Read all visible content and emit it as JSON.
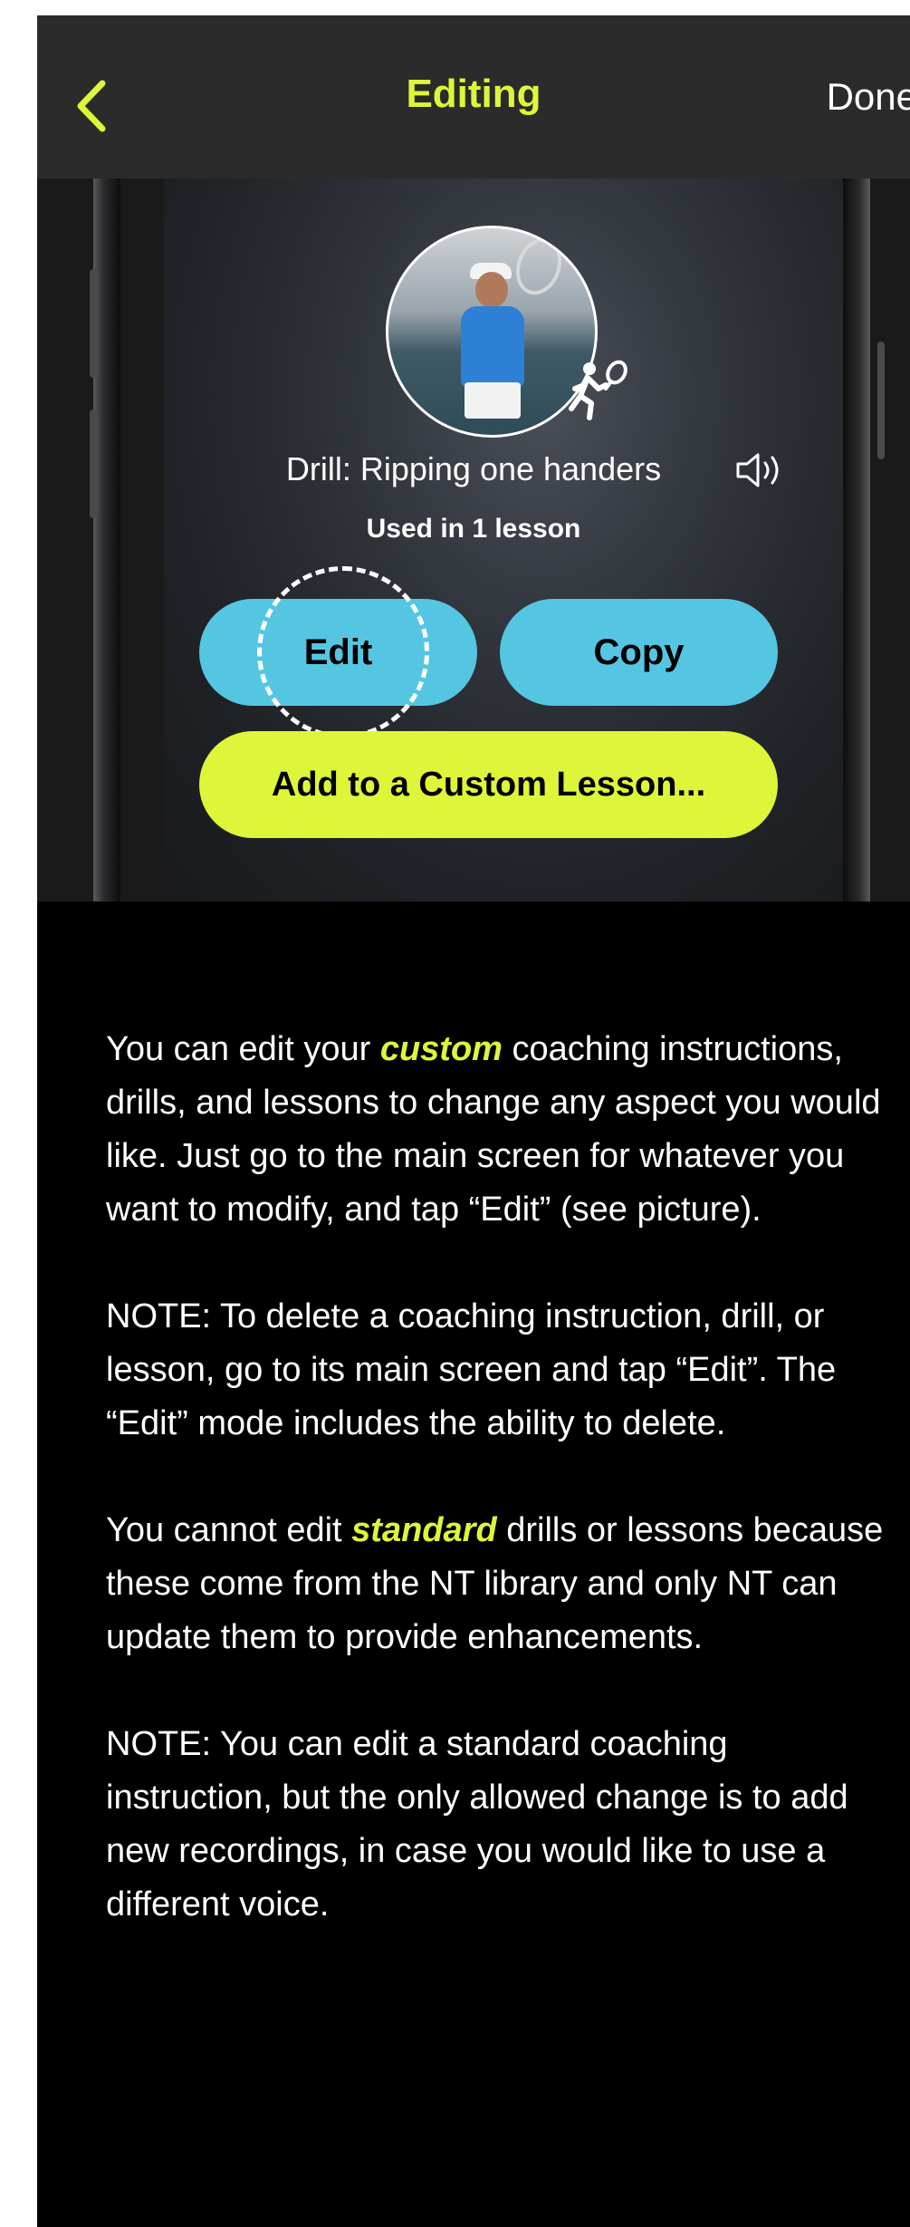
{
  "header": {
    "title": "Editing",
    "done_label": "Done",
    "back_icon": "chevron-left-icon",
    "accent_color": "#dff53a"
  },
  "picture": {
    "drill_title": "Drill: Ripping one handers",
    "used_in": "Used in 1 lesson",
    "edit_label": "Edit",
    "copy_label": "Copy",
    "add_label": "Add to a Custom Lesson...",
    "button_color": "#55c6e2"
  },
  "body": {
    "p1_pre": "You can edit your ",
    "p1_em": "custom",
    "p1_post": " coaching instructions, drills, and lessons to change any aspect you would like. Just go to the main screen for whatever you want to modify, and tap “Edit” (see picture).",
    "p2": "NOTE: To delete a coaching instruction, drill, or lesson, go to its main screen and tap “Edit”. The “Edit” mode includes the ability to delete.",
    "p3_pre": "You cannot edit ",
    "p3_em": "standard",
    "p3_post": " drills or lessons because these come from the NT library and only NT can update them to provide enhancements.",
    "p4": "NOTE: You can edit a standard coaching instruction, but the only allowed change is to add new recordings, in case you would like to use a different voice."
  }
}
